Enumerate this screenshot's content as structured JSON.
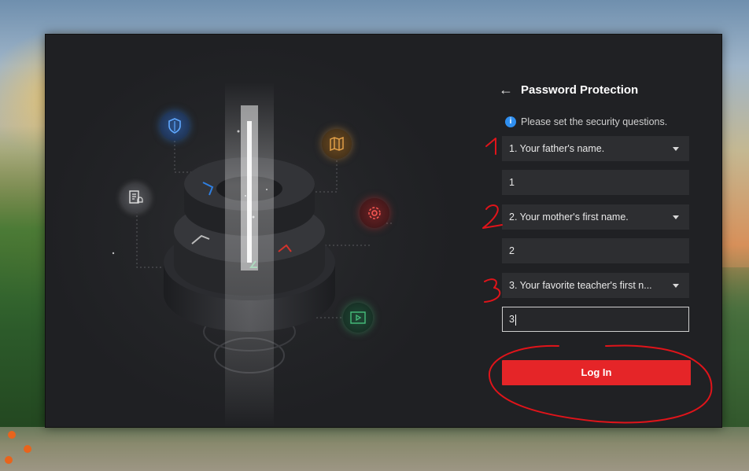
{
  "window": {
    "minimize_glyph": "—",
    "close_glyph": "✕"
  },
  "header": {
    "back_glyph": "←",
    "title": "Password Protection"
  },
  "hint": {
    "icon": "info-icon",
    "text": "Please set the security questions."
  },
  "questions": [
    {
      "label": "1. Your father's name.",
      "answer": "1"
    },
    {
      "label": "2. Your mother's first name.",
      "answer": "2"
    },
    {
      "label": "3. Your favorite teacher's first n...",
      "answer": "3"
    }
  ],
  "login": {
    "label": "Log In"
  },
  "illustration": {
    "icons": [
      "shield-icon",
      "map-icon",
      "document-bell-icon",
      "gear-icon",
      "video-icon"
    ]
  },
  "colors": {
    "accent": "#e52528",
    "info": "#2f8ff0",
    "annotation": "#e0141a"
  }
}
